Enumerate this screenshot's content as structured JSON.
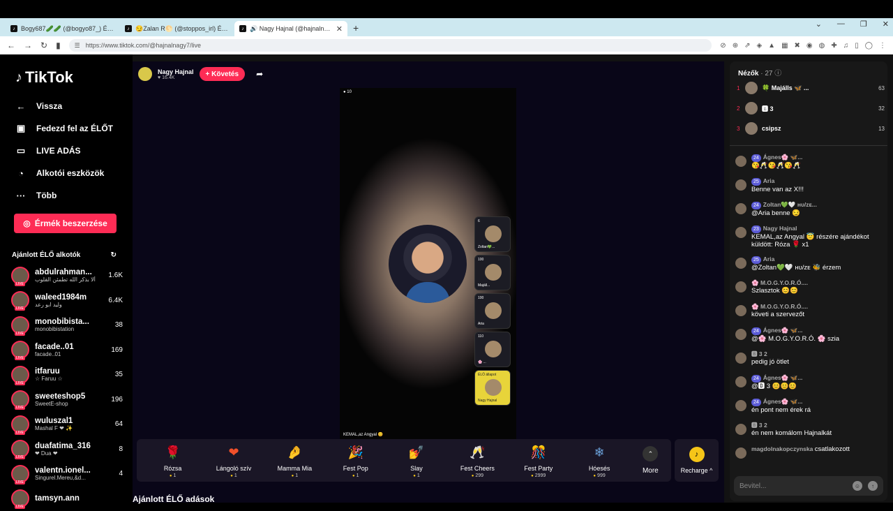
{
  "browser": {
    "tabs": [
      {
        "title": "Bogy687🥒🥒 (@bogyo87_) ÉLŐ a..."
      },
      {
        "title": "😏Zalan R🌕 (@stoppos_irl) ÉLŐ a..."
      },
      {
        "title": "🔊 Nagy Hajnal (@hajnalnag..."
      }
    ],
    "new_tab": "+",
    "url": "https://www.tiktok.com/@hajnalnagy7/live"
  },
  "sidebar": {
    "logo": "TikTok",
    "nav": [
      {
        "label": "Vissza",
        "icon": "back-arrow-icon"
      },
      {
        "label": "Fedezd fel az ÉLŐT",
        "icon": "calendar-icon"
      },
      {
        "label": "LIVE ADÁS",
        "icon": "video-camera-icon"
      },
      {
        "label": "Alkotói eszközök",
        "icon": "lightbulb-icon"
      },
      {
        "label": "Több",
        "icon": "more-dots-icon"
      }
    ],
    "coins_button": "Érmék beszerzése",
    "suggested_heading": "Ajánlott ÉLŐ alkotók",
    "creators": [
      {
        "name": "abdulrahman...",
        "sub": "ألا بذكر الله تطمئن القلوب",
        "count": "1.6K"
      },
      {
        "name": "waleed1984m",
        "sub": "وليد ابو رعد",
        "count": "6.4K"
      },
      {
        "name": "monobibista...",
        "sub": "monobibistation",
        "count": "38"
      },
      {
        "name": "facade..01",
        "sub": "facade..01",
        "count": "169"
      },
      {
        "name": "itfaruu",
        "sub": "☆ Faruu ☆",
        "count": "35"
      },
      {
        "name": "sweeteshop5",
        "sub": "SweetE-shop",
        "count": "196"
      },
      {
        "name": "wuluszal1",
        "sub": "Mashal F ❤ ✨",
        "count": "64"
      },
      {
        "name": "duafatima_316",
        "sub": "❤ Dua ❤",
        "count": "8"
      },
      {
        "name": "valentn.ionel...",
        "sub": "Singurel.Mereu,&d...",
        "count": "4"
      },
      {
        "name": "tamsyn.ann",
        "sub": "",
        "count": ""
      }
    ]
  },
  "stream": {
    "host_name": "Nagy Hajnal",
    "host_likes": "♥ 16.4K",
    "follow_button": "+ Követés",
    "viewer_badge": "10",
    "bottom_label": "KEMAL,az Angyal 😊",
    "guests": [
      {
        "count": "6",
        "label": "Zoltan💚..."
      },
      {
        "count": "100",
        "label": "Majáll..."
      },
      {
        "count": "100",
        "label": "Aria"
      },
      {
        "count": "110",
        "label": "🌸 ..."
      },
      {
        "count": "ÉLŐ állapot",
        "label": "Nagy Hajnal"
      }
    ]
  },
  "gifts": [
    {
      "name": "Rózsa",
      "cost": "1",
      "icon": "rose-icon",
      "glyph": "🌹"
    },
    {
      "name": "Lángoló szív",
      "cost": "1",
      "icon": "flaming-heart-icon",
      "glyph": "❤"
    },
    {
      "name": "Mamma Mia",
      "cost": "1",
      "icon": "hand-icon",
      "glyph": "🤌"
    },
    {
      "name": "Fest Pop",
      "cost": "1",
      "icon": "fest-pop-icon",
      "glyph": "🎉"
    },
    {
      "name": "Slay",
      "cost": "1",
      "icon": "slay-icon",
      "glyph": "💅"
    },
    {
      "name": "Fest Cheers",
      "cost": "299",
      "icon": "cheers-icon",
      "glyph": "🥂"
    },
    {
      "name": "Fest Party",
      "cost": "2999",
      "icon": "party-icon",
      "glyph": "🎊"
    },
    {
      "name": "Hóesés",
      "cost": "999",
      "icon": "snowfall-icon",
      "glyph": "❄"
    }
  ],
  "more_label": "More",
  "recharge_label": "Recharge ^",
  "below_title": "Ajánlott ÉLŐ adások",
  "viewers": {
    "heading": "Nézők",
    "count": "· 27",
    "top": [
      {
        "rank": "1",
        "name": "🍀 Majálls 🦋 ...",
        "score": "63"
      },
      {
        "rank": "2",
        "name": "🅱 3",
        "score": "32"
      },
      {
        "rank": "3",
        "name": "csipsz",
        "score": "13"
      }
    ]
  },
  "chat": [
    {
      "badge": "24",
      "user": "Ágnes🌸 🦋...",
      "text": "😘🥂😘🥂😘🥂"
    },
    {
      "badge": "25",
      "user": "Aria",
      "text": "Benne van az X!!! "
    },
    {
      "badge": "24",
      "user": "Zoltan💚🤍 ʜυ/ᴢᴇ...",
      "text": "@Aria benne 😏"
    },
    {
      "badge": "23",
      "user": "Nagy Hajnal",
      "text": "KEMAL,az Angyal 😇 részére ajándékot küldött: Róza 🌹 x1"
    },
    {
      "badge": "25",
      "user": "Aria",
      "text": "@Zoltan💚🤍 ʜυ/ᴢᴇ 🐝 érzem"
    },
    {
      "badge": "",
      "user": "🌸 M.O.G.Y.O.R.Ó....",
      "text": "Szlasztok 😊😊"
    },
    {
      "badge": "",
      "user": "🌸 M.O.G.Y.O.R.Ó....",
      "text": "követi a szervezőt"
    },
    {
      "badge": "24",
      "user": "Ágnes🌸 🦋...",
      "text": "@🌸 M.O.G.Y.O.R.Ó. 🌸 szia"
    },
    {
      "badge": "",
      "user": "🅱 3  2",
      "text": "pedig jó ötlet"
    },
    {
      "badge": "24",
      "user": "Ágnes🌸 🦋...",
      "text": "@🅱 3 😊😊😊"
    },
    {
      "badge": "24",
      "user": "Ágnes🌸 🦋...",
      "text": "én pont nem érek rá"
    },
    {
      "badge": "",
      "user": "🅱 3  2",
      "text": "én nem komálom Hajnalkát"
    },
    {
      "badge": "",
      "user": "magdolnakopczynska",
      "text": "csatlakozott"
    }
  ],
  "input_placeholder": "Bevitel..."
}
